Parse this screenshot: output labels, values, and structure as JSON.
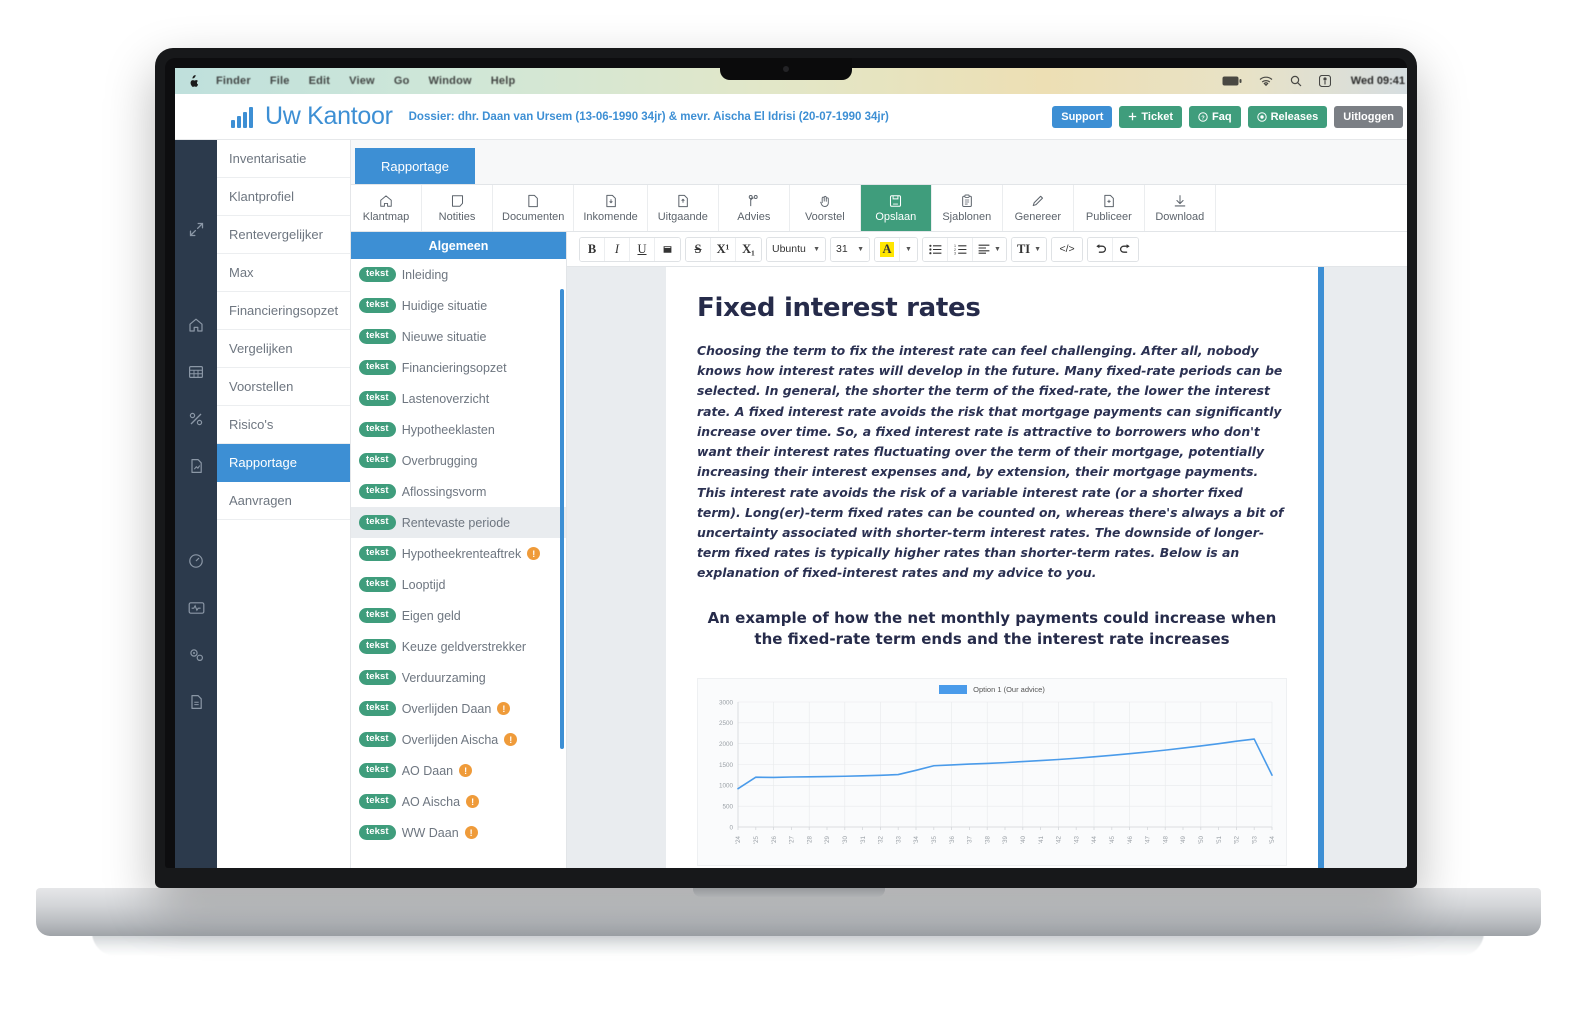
{
  "os_menubar": {
    "apple_icon": "apple-icon",
    "menus": [
      "Finder",
      "File",
      "Edit",
      "View",
      "Go",
      "Window",
      "Help"
    ],
    "status_icons": [
      "battery-icon",
      "wifi-icon",
      "search-icon",
      "control-center-icon"
    ],
    "clock": "Wed 09:41"
  },
  "header": {
    "brand": "Uw Kantoor",
    "dossier": "Dossier: dhr. Daan van Ursem (13-06-1990 34jr) & mevr. Aischa El Idrisi (20-07-1990 34jr)",
    "actions": [
      {
        "label": "Support",
        "style": "blue",
        "icon": ""
      },
      {
        "label": "Ticket",
        "style": "green",
        "icon": "plus-icon"
      },
      {
        "label": "Faq",
        "style": "green",
        "icon": "question-circle-icon"
      },
      {
        "label": "Releases",
        "style": "green",
        "icon": "target-circle-icon"
      },
      {
        "label": "Uitloggen",
        "style": "grey",
        "icon": ""
      }
    ]
  },
  "rail": {
    "icons": [
      "expand-arrows-icon",
      "home-icon",
      "table-icon",
      "percent-icon",
      "file-chart-icon",
      "speedometer-icon",
      "monitor-pulse-icon",
      "gears-icon",
      "document-icon"
    ]
  },
  "sidebar": {
    "items": [
      {
        "label": "Inventarisatie",
        "active": false
      },
      {
        "label": "Klantprofiel",
        "active": false
      },
      {
        "label": "Rentevergelijker",
        "active": false
      },
      {
        "label": "Max",
        "active": false
      },
      {
        "label": "Financieringsopzet",
        "active": false
      },
      {
        "label": "Vergelijken",
        "active": false
      },
      {
        "label": "Voorstellen",
        "active": false
      },
      {
        "label": "Risico's",
        "active": false
      },
      {
        "label": "Rapportage",
        "active": true
      },
      {
        "label": "Aanvragen",
        "active": false
      }
    ]
  },
  "main": {
    "tab": "Rapportage",
    "modules": [
      {
        "label": "Klantmap",
        "icon": "home-icon",
        "active": false
      },
      {
        "label": "Notities",
        "icon": "note-icon",
        "active": false
      },
      {
        "label": "Documenten",
        "icon": "file-icon",
        "active": false
      },
      {
        "label": "Inkomende",
        "icon": "file-download-icon",
        "active": false
      },
      {
        "label": "Uitgaande",
        "icon": "file-upload-icon",
        "active": false
      },
      {
        "label": "Advies",
        "icon": "branch-icon",
        "active": false
      },
      {
        "label": "Voorstel",
        "icon": "hand-icon",
        "active": false
      },
      {
        "label": "Opslaan",
        "icon": "save-icon",
        "active": true
      },
      {
        "label": "Sjablonen",
        "icon": "clipboard-icon",
        "active": false
      },
      {
        "label": "Genereer",
        "icon": "pencil-icon",
        "active": false
      },
      {
        "label": "Publiceer",
        "icon": "file-plus-icon",
        "active": false
      },
      {
        "label": "Download",
        "icon": "download-icon",
        "active": false
      }
    ]
  },
  "blocklist": {
    "title": "Algemeen",
    "badge_label": "tekst",
    "warn_label": "!",
    "items": [
      {
        "label": "Inleiding",
        "warn": false,
        "selected": false
      },
      {
        "label": "Huidige situatie",
        "warn": false,
        "selected": false
      },
      {
        "label": "Nieuwe situatie",
        "warn": false,
        "selected": false
      },
      {
        "label": "Financieringsopzet",
        "warn": false,
        "selected": false
      },
      {
        "label": "Lastenoverzicht",
        "warn": false,
        "selected": false
      },
      {
        "label": "Hypotheeklasten",
        "warn": false,
        "selected": false
      },
      {
        "label": "Overbrugging",
        "warn": false,
        "selected": false
      },
      {
        "label": "Aflossingsvorm",
        "warn": false,
        "selected": false
      },
      {
        "label": "Rentevaste periode",
        "warn": false,
        "selected": true
      },
      {
        "label": "Hypotheekrenteaftrek",
        "warn": true,
        "selected": false
      },
      {
        "label": "Looptijd",
        "warn": false,
        "selected": false
      },
      {
        "label": "Eigen geld",
        "warn": false,
        "selected": false
      },
      {
        "label": "Keuze geldverstrekker",
        "warn": false,
        "selected": false
      },
      {
        "label": "Verduurzaming",
        "warn": false,
        "selected": false
      },
      {
        "label": "Overlijden Daan",
        "warn": true,
        "selected": false
      },
      {
        "label": "Overlijden Aischa",
        "warn": true,
        "selected": false
      },
      {
        "label": "AO Daan",
        "warn": true,
        "selected": false
      },
      {
        "label": "AO Aischa",
        "warn": true,
        "selected": false
      },
      {
        "label": "WW Daan",
        "warn": true,
        "selected": false
      }
    ]
  },
  "editor_toolbar": {
    "groups": [
      {
        "buttons": [
          {
            "label": "B",
            "name": "bold-button",
            "style": "bold"
          },
          {
            "label": "I",
            "name": "italic-button",
            "style": "italic"
          },
          {
            "label": "U",
            "name": "underline-button",
            "style": "underline"
          },
          {
            "label": "█",
            "name": "remove-format-button",
            "style": "plain"
          }
        ]
      },
      {
        "buttons": [
          {
            "label": "S",
            "name": "strikethrough-button",
            "style": "strike"
          },
          {
            "label": "X¹",
            "name": "superscript-button",
            "style": "plain"
          },
          {
            "label": "X₁",
            "name": "subscript-button",
            "style": "plain"
          }
        ]
      },
      {
        "buttons": [
          {
            "label": "Ubuntu",
            "name": "font-family-select",
            "style": "dropdown"
          }
        ]
      },
      {
        "buttons": [
          {
            "label": "31",
            "name": "font-size-select",
            "style": "dropdown"
          }
        ]
      },
      {
        "buttons": [
          {
            "label": "A",
            "name": "text-color-button",
            "style": "highlight-a"
          },
          {
            "label": "",
            "name": "text-color-dropdown",
            "style": "caret-only"
          }
        ]
      },
      {
        "buttons": [
          {
            "label": "☰",
            "name": "bullet-list-button",
            "style": "plain"
          },
          {
            "label": "☷",
            "name": "numbered-list-button",
            "style": "plain"
          },
          {
            "label": "≡",
            "name": "align-button",
            "style": "dropdown-icon"
          }
        ]
      },
      {
        "buttons": [
          {
            "label": "TI",
            "name": "paragraph-style-button",
            "style": "dropdown-icon"
          }
        ]
      },
      {
        "buttons": [
          {
            "label": "</>",
            "name": "source-code-button",
            "style": "plain"
          }
        ]
      },
      {
        "buttons": [
          {
            "label": "↶",
            "name": "undo-button",
            "style": "plain"
          },
          {
            "label": "↷",
            "name": "redo-button",
            "style": "plain"
          }
        ]
      }
    ]
  },
  "document": {
    "title": "Fixed interest rates",
    "paragraph": "Choosing the term to fix the interest rate can feel challenging. After all, nobody knows how interest rates will develop in the future. Many fixed-rate periods can be selected. In general, the shorter the term of the fixed-rate, the lower the interest rate. A fixed interest rate avoids the risk that mortgage payments can significantly increase over time. So, a fixed interest rate is attractive to borrowers who don't want their interest rates fluctuating over the term of their mortgage, potentially increasing their interest expenses and, by extension, their mortgage payments. This interest rate avoids the risk of a variable interest rate (or a shorter fixed term). Long(er)-term fixed rates can be counted on, whereas there's always a bit of uncertainty associated with shorter-term interest rates. The downside of longer-term fixed rates is typically higher rates than shorter-term rates. Below is an explanation of fixed-interest rates and my advice to you.",
    "subheading": "An example of how the net monthly payments could increase when the fixed-rate term ends and the interest rate increases"
  },
  "chart_data": {
    "type": "line",
    "title": "",
    "xlabel": "",
    "ylabel": "",
    "legend": [
      "Option 1 (Our advice)"
    ],
    "legend_position": "top-center",
    "grid": true,
    "ylim": [
      0,
      3000
    ],
    "yticks": [
      0,
      500,
      1000,
      1500,
      2000,
      2500,
      3000
    ],
    "x": [
      "'24",
      "'25",
      "'26",
      "'27",
      "'28",
      "'29",
      "'30",
      "'31",
      "'32",
      "'33",
      "'34",
      "'35",
      "'36",
      "'37",
      "'38",
      "'39",
      "'40",
      "'41",
      "'42",
      "'43",
      "'44",
      "'45",
      "'46",
      "'47",
      "'48",
      "'49",
      "'50",
      "'51",
      "'52",
      "'53",
      "'54"
    ],
    "series": [
      {
        "name": "Option 1 (Our advice)",
        "color": "#4a9bea",
        "values": [
          920,
          1195,
          1190,
          1200,
          1205,
          1210,
          1218,
          1228,
          1240,
          1258,
          1360,
          1470,
          1490,
          1510,
          1525,
          1545,
          1570,
          1595,
          1620,
          1650,
          1685,
          1720,
          1760,
          1800,
          1845,
          1895,
          1945,
          2000,
          2060,
          2110,
          1245
        ]
      }
    ]
  }
}
